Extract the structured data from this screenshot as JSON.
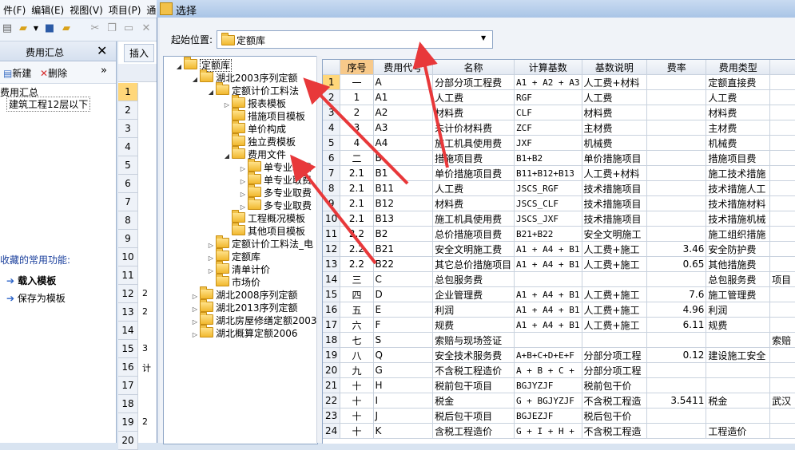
{
  "app": {
    "menu": [
      "件(F)",
      "编辑(E)",
      "视图(V)",
      "项目(P)",
      "通"
    ],
    "left_panel_title": "费用汇总",
    "new_label": "新建",
    "delete_label": "删除",
    "tree_root": "费用汇总",
    "tree_child": "建筑工程12层以下",
    "fav_title": "收藏的常用功能:",
    "fav_items": [
      "载入模板",
      "保存为模板"
    ],
    "insert_label": "插入",
    "grid_rows": [
      "1",
      "2",
      "3",
      "4",
      "5",
      "6",
      "7",
      "8",
      "9",
      "10",
      "11",
      "12",
      "13",
      "14",
      "15",
      "16",
      "17",
      "18",
      "19",
      "20"
    ],
    "grid_col_values": {
      "12": "2",
      "13": "2",
      "15": "3",
      "16": "计",
      "19": "2"
    }
  },
  "dialog": {
    "title": "选择",
    "start_label": "起始位置:",
    "start_value": "定额库",
    "tree": [
      {
        "label": "定额库",
        "level": 0,
        "exp": "◢",
        "selected": true
      },
      {
        "label": "湖北2003序列定额",
        "level": 1,
        "exp": "◢"
      },
      {
        "label": "定额计价工料法",
        "level": 2,
        "exp": "◢"
      },
      {
        "label": "报表模板",
        "level": 3,
        "exp": "▷"
      },
      {
        "label": "措施项目模板",
        "level": 3,
        "exp": ""
      },
      {
        "label": "单价构成",
        "level": 3,
        "exp": ""
      },
      {
        "label": "独立费模板",
        "level": 3,
        "exp": ""
      },
      {
        "label": "费用文件",
        "level": 3,
        "exp": "◢"
      },
      {
        "label": "单专业取费",
        "level": 4,
        "exp": "▷"
      },
      {
        "label": "单专业取费",
        "level": 4,
        "exp": "▷"
      },
      {
        "label": "多专业取费",
        "level": 4,
        "exp": "▷"
      },
      {
        "label": "多专业取费",
        "level": 4,
        "exp": "▷"
      },
      {
        "label": "工程概况模板",
        "level": 3,
        "exp": ""
      },
      {
        "label": "其他项目模板",
        "level": 3,
        "exp": ""
      },
      {
        "label": "定额计价工料法_电",
        "level": 2,
        "exp": "▷"
      },
      {
        "label": "定额库",
        "level": 2,
        "exp": "▷"
      },
      {
        "label": "清单计价",
        "level": 2,
        "exp": "▷"
      },
      {
        "label": "市场价",
        "level": 2,
        "exp": ""
      },
      {
        "label": "湖北2008序列定额",
        "level": 1,
        "exp": "▷"
      },
      {
        "label": "湖北2013序列定额",
        "level": 1,
        "exp": "▷"
      },
      {
        "label": "湖北房屋修缮定额2003",
        "level": 1,
        "exp": "▷"
      },
      {
        "label": "湖北概算定额2006",
        "level": 1,
        "exp": "▷"
      }
    ],
    "columns": [
      "序号",
      "费用代号",
      "名称",
      "计算基数",
      "基数说明",
      "费率",
      "费用类型",
      ""
    ],
    "rows": [
      [
        "1",
        "一",
        "A",
        "分部分项工程费",
        "A1 + A2 + A3",
        "人工费+材料",
        "",
        "定额直接费",
        ""
      ],
      [
        "2",
        "1",
        "A1",
        "人工费",
        "RGF",
        "人工费",
        "",
        "人工费",
        ""
      ],
      [
        "3",
        "2",
        "A2",
        "材料费",
        "CLF",
        "材料费",
        "",
        "材料费",
        ""
      ],
      [
        "4",
        "3",
        "A3",
        "未计价材料费",
        "ZCF",
        "主材费",
        "",
        "主材费",
        ""
      ],
      [
        "5",
        "4",
        "A4",
        "施工机具使用费",
        "JXF",
        "机械费",
        "",
        "机械费",
        ""
      ],
      [
        "6",
        "二",
        "B",
        "措施项目费",
        "B1+B2",
        "单价措施项目",
        "",
        "措施项目费",
        ""
      ],
      [
        "7",
        "2.1",
        "B1",
        "单价措施项目费",
        "B11+B12+B13",
        "人工费+材料",
        "",
        "施工技术措施",
        ""
      ],
      [
        "8",
        "2.1",
        "B11",
        "人工费",
        "JSCS_RGF",
        "技术措施项目",
        "",
        "技术措施人工",
        ""
      ],
      [
        "9",
        "2.1",
        "B12",
        "材料费",
        "JSCS_CLF",
        "技术措施项目",
        "",
        "技术措施材料",
        ""
      ],
      [
        "10",
        "2.1",
        "B13",
        "施工机具使用费",
        "JSCS_JXF",
        "技术措施项目",
        "",
        "技术措施机械",
        ""
      ],
      [
        "11",
        "2.2",
        "B2",
        "总价措施项目费",
        "B21+B22",
        "安全文明施工",
        "",
        "施工组织措施",
        ""
      ],
      [
        "12",
        "2.2",
        "B21",
        "安全文明施工费",
        "A1 + A4 + B1",
        "人工费+施工",
        "3.46",
        "安全防护费",
        ""
      ],
      [
        "13",
        "2.2",
        "B22",
        "其它总价措施项目",
        "A1 + A4 + B1",
        "人工费+施工",
        "0.65",
        "其他措施费",
        ""
      ],
      [
        "14",
        "三",
        "C",
        "总包服务费",
        "",
        "",
        "",
        "总包服务费",
        "项目"
      ],
      [
        "15",
        "四",
        "D",
        "企业管理费",
        "A1 + A4 + B1",
        "人工费+施工",
        "7.6",
        "施工管理费",
        ""
      ],
      [
        "16",
        "五",
        "E",
        "利润",
        "A1 + A4 + B1",
        "人工费+施工",
        "4.96",
        "利润",
        ""
      ],
      [
        "17",
        "六",
        "F",
        "规费",
        "A1 + A4 + B1",
        "人工费+施工",
        "6.11",
        "规费",
        ""
      ],
      [
        "18",
        "七",
        "S",
        "索赔与现场签证",
        "",
        "",
        "",
        "",
        "索赔"
      ],
      [
        "19",
        "八",
        "Q",
        "安全技术服务费",
        "A+B+C+D+E+F",
        "分部分项工程",
        "0.12",
        "建设施工安全",
        ""
      ],
      [
        "20",
        "九",
        "G",
        "不含税工程造价",
        "A + B + C +",
        "分部分项工程",
        "",
        "",
        ""
      ],
      [
        "21",
        "十",
        "H",
        "税前包干项目",
        "BGJYZJF",
        "税前包干价",
        "",
        "",
        ""
      ],
      [
        "22",
        "十",
        "I",
        "税金",
        "G + BGJYZJF",
        "不含税工程造",
        "3.5411",
        "税金",
        "武汉"
      ],
      [
        "23",
        "十",
        "J",
        "税后包干项目",
        "BGJEZJF",
        "税后包干价",
        "",
        "",
        ""
      ],
      [
        "24",
        "十",
        "K",
        "含税工程造价",
        "G + I + H +",
        "不含税工程造",
        "",
        "工程造价",
        ""
      ]
    ]
  },
  "colors": {
    "arrow": "#e8383a",
    "header_seq": "#f7c98a",
    "selection": "#ffd77a"
  }
}
